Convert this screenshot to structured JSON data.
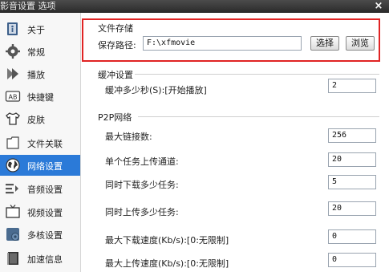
{
  "window": {
    "title": "影音设置 选项",
    "close_glyph": "×"
  },
  "sidebar": {
    "items": [
      {
        "label": "关于",
        "icon": "info-book-icon"
      },
      {
        "label": "常规",
        "icon": "gear-icon"
      },
      {
        "label": "播放",
        "icon": "play-arrows-icon"
      },
      {
        "label": "快捷键",
        "icon": "keyboard-ab-icon"
      },
      {
        "label": "皮肤",
        "icon": "tshirt-icon"
      },
      {
        "label": "文件关联",
        "icon": "file-icon"
      },
      {
        "label": "网络设置",
        "icon": "globe-icon",
        "active": true
      },
      {
        "label": "音频设置",
        "icon": "audio-icon"
      },
      {
        "label": "视频设置",
        "icon": "tv-icon"
      },
      {
        "label": "多核设置",
        "icon": "cpu-icon"
      },
      {
        "label": "加速信息",
        "icon": "book-icon"
      }
    ],
    "active_color": "#2b7ad8"
  },
  "file_storage": {
    "title": "文件存储",
    "path_label": "保存路径:",
    "path_value": "F:\\xfmovie",
    "select_button": "选择",
    "browse_button": "浏览",
    "highlight_color": "#e02424"
  },
  "buffer": {
    "title": "缓冲设置",
    "label": "缓冲多少秒(S):[开始播放]",
    "value": "2"
  },
  "p2p": {
    "title": "P2P网络",
    "rows": [
      {
        "label": "最大链接数:",
        "value": "256"
      },
      {
        "label": "单个任务上传通道:",
        "value": "20"
      },
      {
        "label": "同时下载多少任务:",
        "value": "5"
      },
      {
        "label": "同时上传多少任务:",
        "value": "20"
      },
      {
        "label": "最大下载速度(Kb/s):[0:无限制]",
        "value": "0"
      },
      {
        "label": "最大上传速度(Kb/s):[0:无限制]",
        "value": "0"
      }
    ]
  }
}
